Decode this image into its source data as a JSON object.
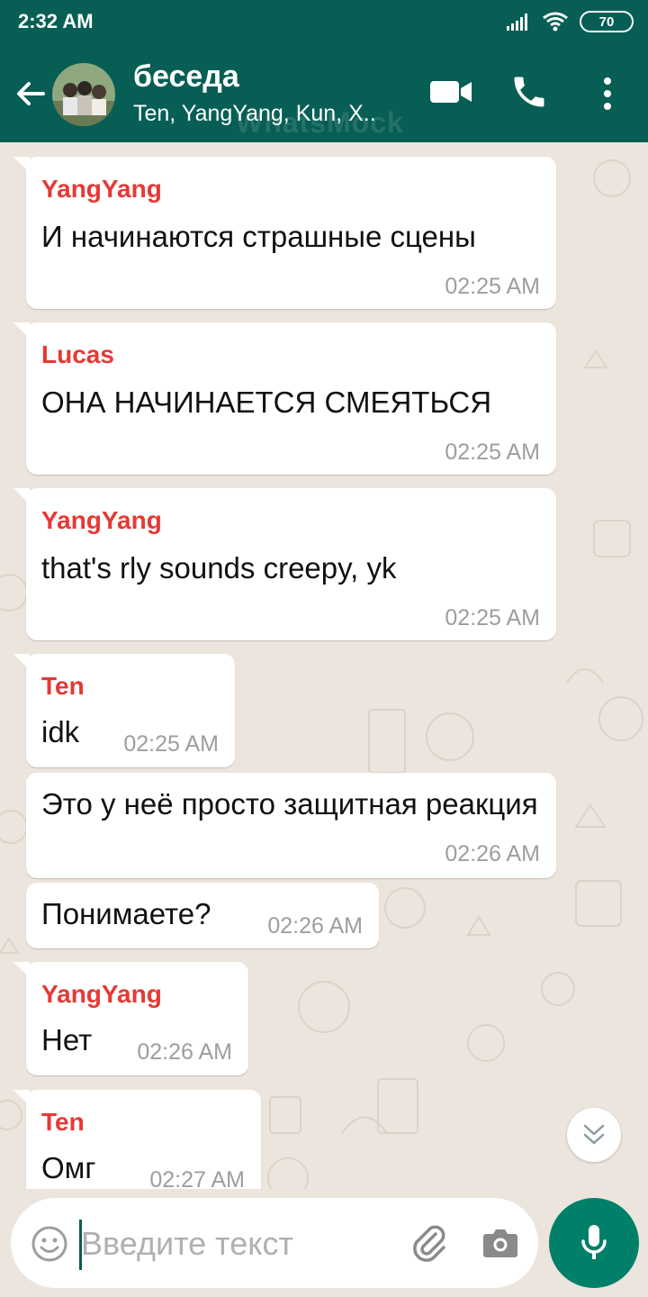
{
  "status_bar": {
    "time": "2:32 AM",
    "battery": "70"
  },
  "header": {
    "title": "беседа",
    "subtitle": "Ten, YangYang, Kun, X..",
    "watermark": "WhatsMock"
  },
  "messages": [
    {
      "sender": "YangYang",
      "text": "И начинаются страшные сцены",
      "time": "02:25 AM"
    },
    {
      "sender": "Lucas",
      "text": "ОНА НАЧИНАЕТСЯ СМЕЯТЬСЯ",
      "time": "02:25 AM"
    },
    {
      "sender": "YangYang",
      "text": "that's rly sounds creepy, yk",
      "time": "02:25 AM"
    },
    {
      "sender": "Ten",
      "text": "idk",
      "time": "02:25 AM"
    },
    {
      "sender": "",
      "text": "Это у неё просто защитная реакция",
      "time": "02:26 AM"
    },
    {
      "sender": "",
      "text": "Понимаете?",
      "time": "02:26 AM"
    },
    {
      "sender": "YangYang",
      "text": "Нет",
      "time": "02:26 AM"
    },
    {
      "sender": "Ten",
      "text": "Омг",
      "time": "02:27 AM"
    }
  ],
  "input": {
    "placeholder": "Введите текст",
    "value": ""
  },
  "colors": {
    "header": "#075e54",
    "accent": "#008069",
    "sender_name": "#e53935",
    "chat_background": "#ece5dd"
  },
  "icons": [
    "back-arrow-icon",
    "video-call-icon",
    "phone-icon",
    "more-vert-icon",
    "emoji-icon",
    "attach-icon",
    "camera-icon",
    "mic-icon",
    "double-chevron-down-icon"
  ]
}
